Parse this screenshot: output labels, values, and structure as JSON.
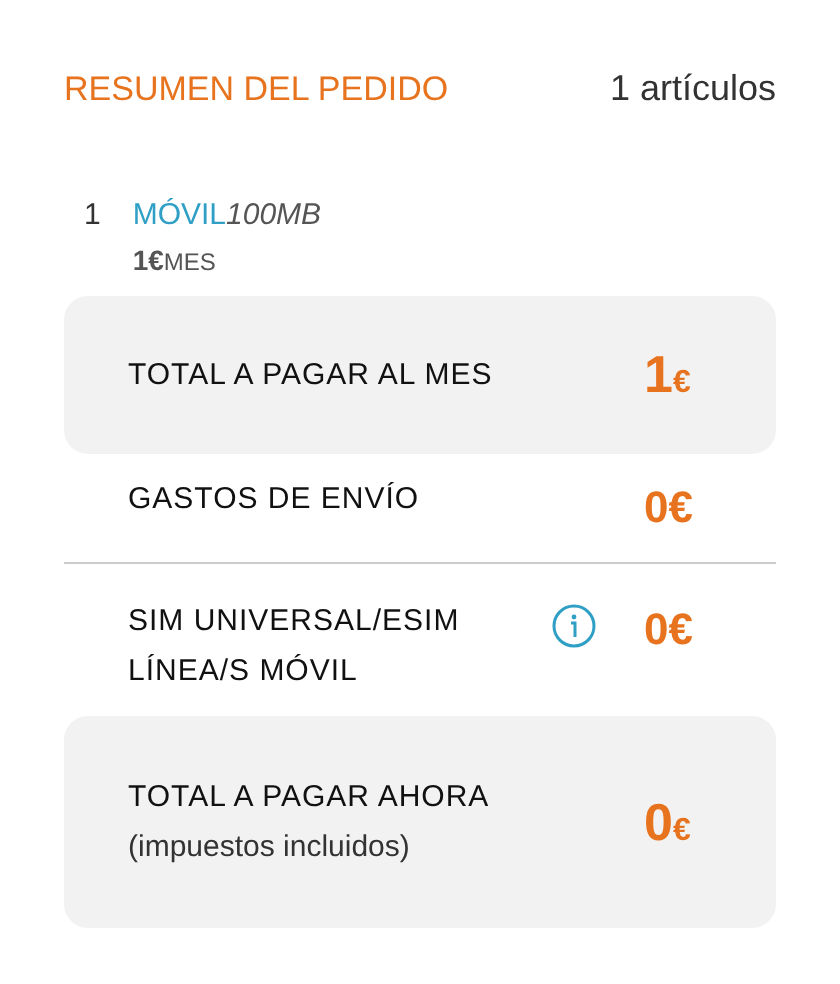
{
  "header": {
    "title": "RESUMEN DEL PEDIDO",
    "count": "1 artículos"
  },
  "items": [
    {
      "quantity": "1",
      "name": "MÓVIL",
      "detail": "100MB",
      "price": "1€",
      "period": "MES"
    }
  ],
  "rows": [
    {
      "kind": "highlight",
      "lines": [
        "TOTAL A PAGAR AL MES"
      ],
      "amount": "1",
      "currency": "€",
      "info": false,
      "divider": false
    },
    {
      "kind": "plain",
      "lines": [
        "GASTOS DE ENVÍO"
      ],
      "amount": "0",
      "currency": "€",
      "info": false,
      "divider": true
    },
    {
      "kind": "plain",
      "lines": [
        "SIM UNIVERSAL/ESIM",
        "LÍNEA/S MÓVIL"
      ],
      "amount": "0",
      "currency": "€",
      "info": true,
      "divider": false
    },
    {
      "kind": "highlight",
      "lines": [
        "TOTAL A PAGAR AHORA"
      ],
      "note": "(impuestos incluidos)",
      "amount": "0",
      "currency": "€",
      "info": false,
      "divider": false
    }
  ]
}
